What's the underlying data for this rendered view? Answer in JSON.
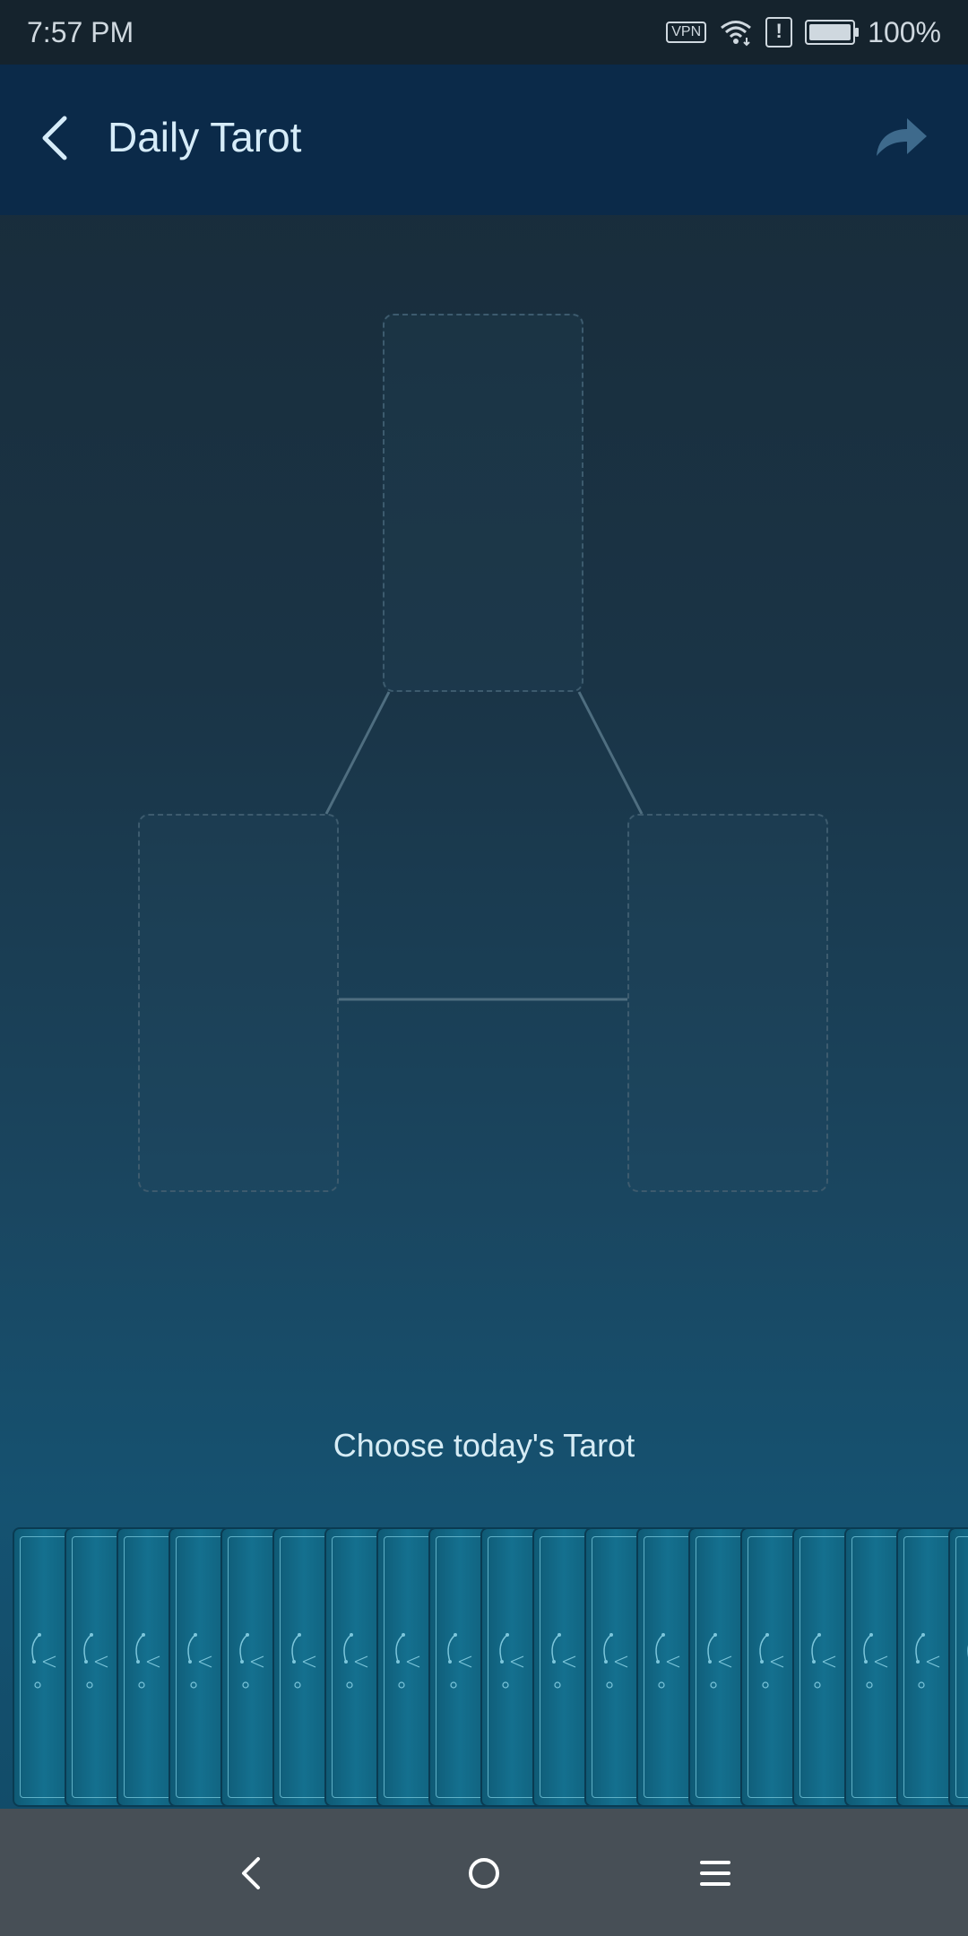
{
  "status_bar": {
    "time": "7:57 PM",
    "vpn": "VPN",
    "battery": "100%",
    "icons": [
      "vpn-icon",
      "wifi-icon",
      "alert-icon",
      "battery-icon"
    ]
  },
  "app_bar": {
    "title": "Daily Tarot",
    "back_icon": "back-arrow-icon",
    "share_icon": "share-icon"
  },
  "spread": {
    "slots": [
      "top-card-slot",
      "left-card-slot",
      "right-card-slot"
    ]
  },
  "prompt": "Choose today's Tarot",
  "deck": {
    "card_count": 19
  },
  "nav_bar": {
    "icons": [
      "nav-back-icon",
      "nav-home-icon",
      "nav-menu-icon"
    ]
  },
  "colors": {
    "app_bar": "#0b2a49",
    "status_bar": "#15232d",
    "card": "#14708f",
    "nav_bar": "#474f56"
  }
}
